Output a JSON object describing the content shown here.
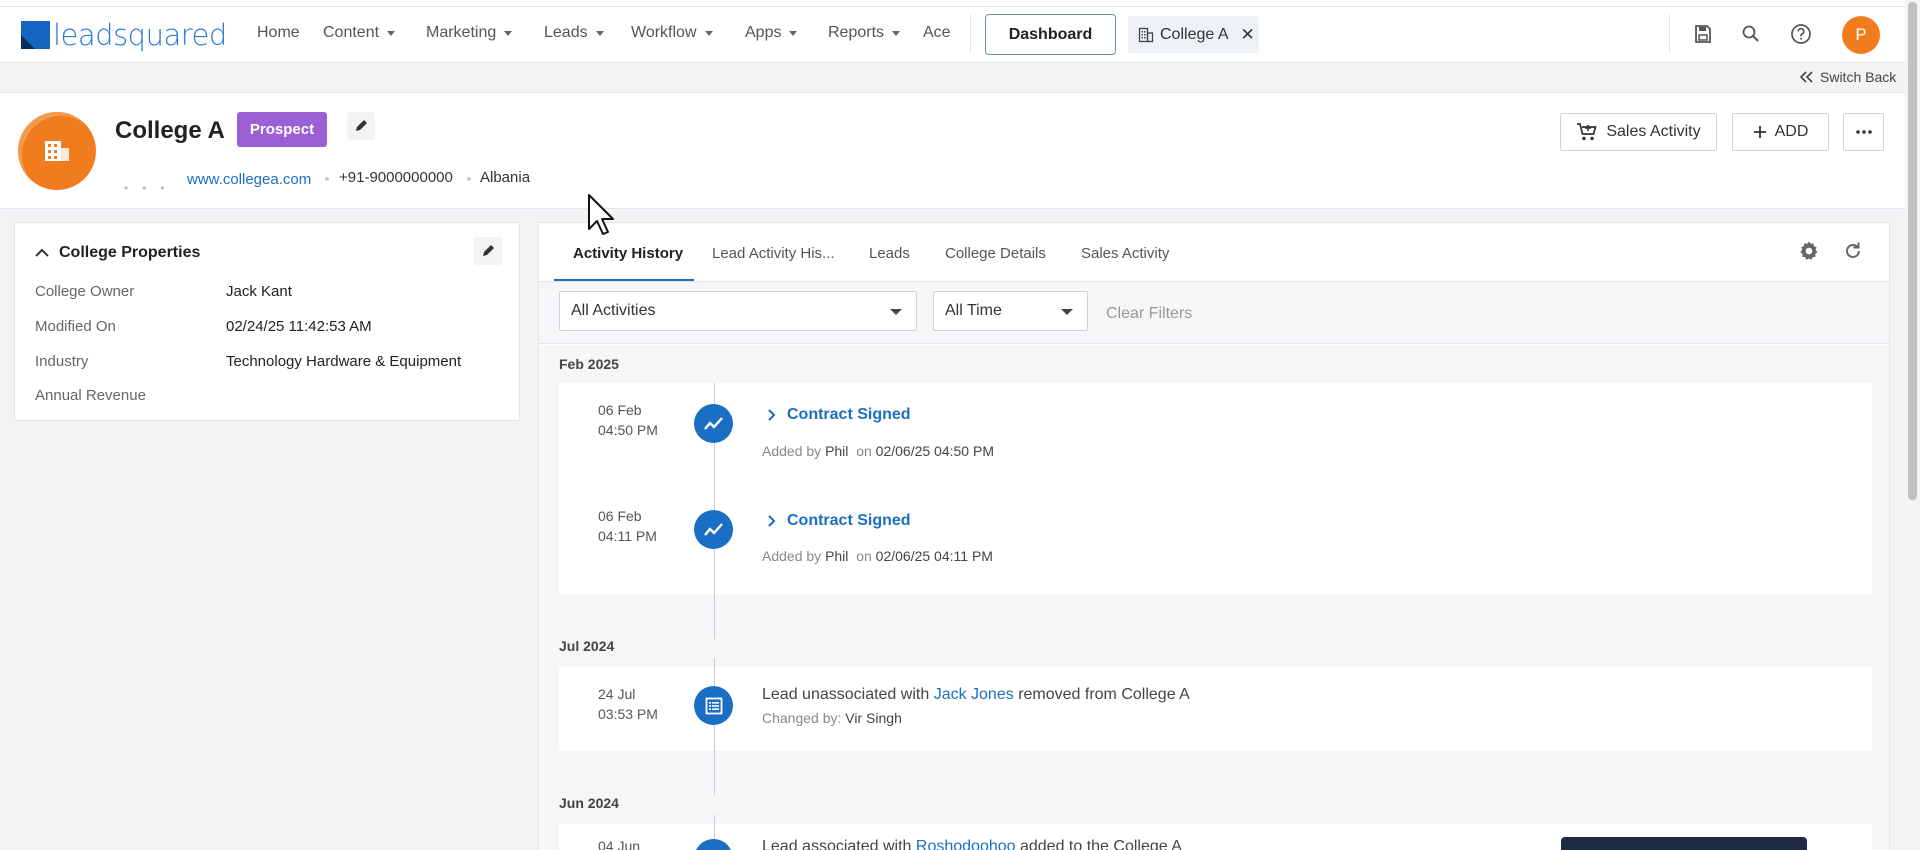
{
  "brand": {
    "name": "leadsquared"
  },
  "nav": {
    "items": [
      {
        "label": "Home",
        "has_caret": false
      },
      {
        "label": "Content",
        "has_caret": true
      },
      {
        "label": "Marketing",
        "has_caret": true
      },
      {
        "label": "Leads",
        "has_caret": true
      },
      {
        "label": "Workflow",
        "has_caret": true
      },
      {
        "label": "Apps",
        "has_caret": true
      },
      {
        "label": "Reports",
        "has_caret": true
      },
      {
        "label": "Ace",
        "has_caret": false
      }
    ],
    "dashboard_label": "Dashboard",
    "open_tab_label": "College A",
    "close_glyph": "✕",
    "user_initial": "P",
    "icons": [
      "save-icon",
      "search-icon",
      "help-icon"
    ]
  },
  "switch_back_label": "Switch Back",
  "header": {
    "company_name": "College A",
    "stage_badge": "Prospect",
    "website": "www.collegea.com",
    "phone": "+91-9000000000",
    "country": "Albania",
    "sales_activity_label": "Sales Activity",
    "add_label": "ADD",
    "more_glyph": "···"
  },
  "properties": {
    "title": "College Properties",
    "rows": [
      {
        "label": "College Owner",
        "value": "Jack Kant"
      },
      {
        "label": "Modified On",
        "value": "02/24/25 11:42:53 AM"
      },
      {
        "label": "Industry",
        "value": "Technology Hardware & Equipment"
      },
      {
        "label": "Annual Revenue",
        "value": ""
      }
    ]
  },
  "activity": {
    "tabs": [
      {
        "label": "Activity History",
        "active": true
      },
      {
        "label": "Lead Activity His...",
        "active": false
      },
      {
        "label": "Leads",
        "active": false
      },
      {
        "label": "College Details",
        "active": false
      },
      {
        "label": "Sales Activity",
        "active": false
      }
    ],
    "filters": {
      "activity_type": "All Activities",
      "time_range": "All Time",
      "clear_label": "Clear Filters"
    },
    "groups": [
      {
        "month": "Feb 2025",
        "entries": [
          {
            "day": "06 Feb",
            "time": "04:50 PM",
            "title": "Contract Signed",
            "added_by_prefix": "Added by",
            "added_by": "Phil",
            "on_prefix": "on",
            "on": "02/06/25 04:50 PM"
          },
          {
            "day": "06 Feb",
            "time": "04:11 PM",
            "title": "Contract Signed",
            "added_by_prefix": "Added by",
            "added_by": "Phil",
            "on_prefix": "on",
            "on": "02/06/25 04:11 PM"
          }
        ]
      },
      {
        "month": "Jul 2024",
        "entries": [
          {
            "day": "24 Jul",
            "time": "03:53 PM",
            "text_before": "Lead unassociated with",
            "link": "Jack Jones",
            "text_after": "removed from College A",
            "changed_by_prefix": "Changed by:",
            "changed_by": "Vir Singh"
          }
        ]
      },
      {
        "month": "Jun 2024",
        "entries": [
          {
            "day": "04 Jun",
            "text_before": "Lead associated with",
            "link": "Roshodoohoo",
            "text_after": "added to the College A"
          }
        ]
      }
    ]
  },
  "colors": {
    "accent": "#1a6fc4",
    "brand_orange": "#f07c1e",
    "badge_purple": "#9c5fd4"
  }
}
